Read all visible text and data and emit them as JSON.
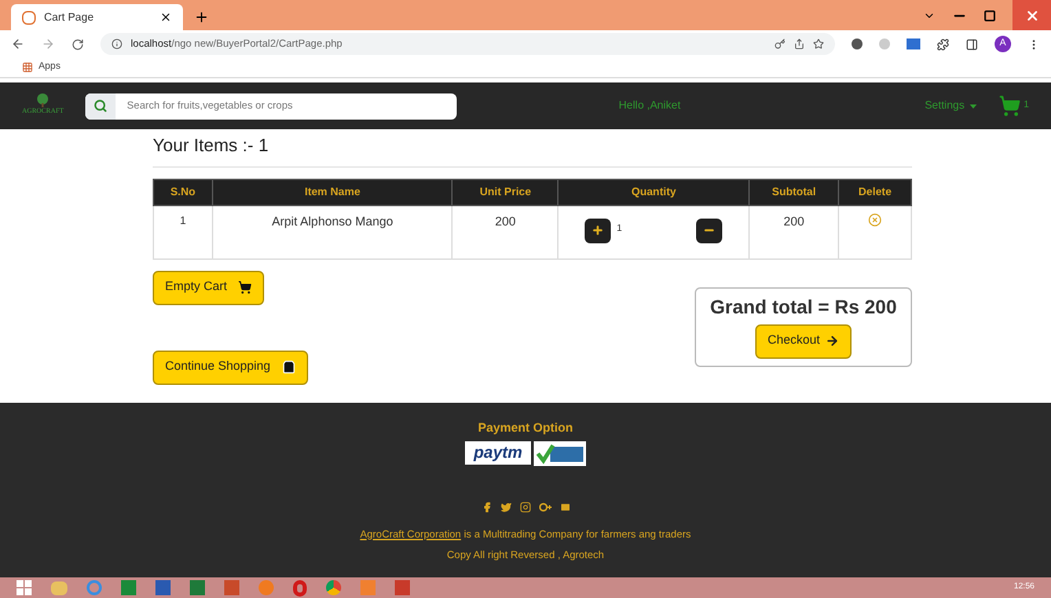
{
  "browser": {
    "tab_title": "Cart Page",
    "url_host": "localhost",
    "url_path": "/ngo new/BuyerPortal2/CartPage.php",
    "bookmarks": [
      "Apps"
    ],
    "profile_initial": "A"
  },
  "navbar": {
    "brand": "AGROCRAFT",
    "search_placeholder": "Search for fruits,vegetables or crops",
    "greeting": "Hello ,Aniket",
    "settings": "Settings",
    "cart_count": "1"
  },
  "cart": {
    "heading": "Your Items :- 1",
    "columns": [
      "S.No",
      "Item Name",
      "Unit Price",
      "Quantity",
      "Subtotal",
      "Delete"
    ],
    "rows": [
      {
        "sno": "1",
        "name": "Arpit Alphonso Mango",
        "unit_price": "200",
        "quantity": "1",
        "subtotal": "200"
      }
    ],
    "empty_cart": "Empty Cart",
    "continue_shopping": "Continue Shopping",
    "grand_total": "Grand total = Rs 200",
    "checkout": "Checkout"
  },
  "footer": {
    "payment_title": "Payment Option",
    "paytm": "paytm",
    "about_link": "AgroCraft Corporation",
    "about_text": " is a Multitrading Company for farmers ang traders",
    "copyright": "Copy All right Reversed , Agrotech"
  },
  "taskbar": {
    "time": "12:56"
  }
}
